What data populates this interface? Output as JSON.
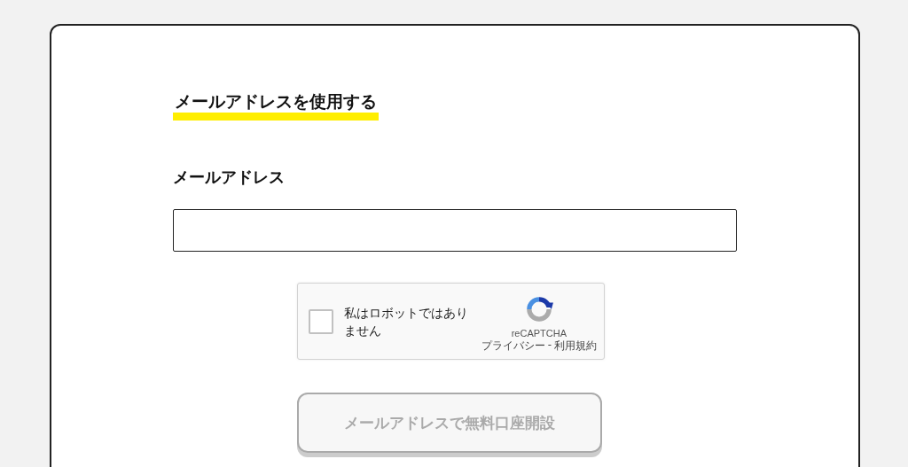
{
  "section_title": "メールアドレスを使用する",
  "email": {
    "label": "メールアドレス"
  },
  "captcha": {
    "label": "私はロボットではありません",
    "checked": false,
    "brand": "reCAPTCHA",
    "privacy_link": "プライバシー",
    "separator": "-",
    "terms_link": "利用規約"
  },
  "submit": {
    "label": "メールアドレスで無料口座開設",
    "disabled": true
  }
}
